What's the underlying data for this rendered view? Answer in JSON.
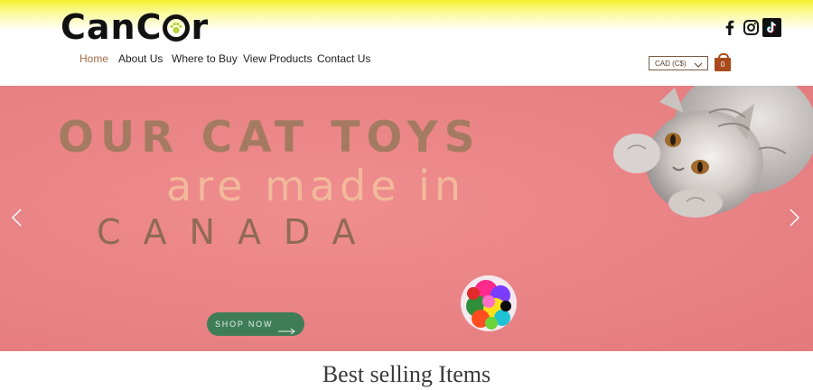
{
  "header": {
    "logo": {
      "prefix": "CanC",
      "suffix": "r"
    },
    "nav": [
      {
        "label": "Home",
        "active": true
      },
      {
        "label": "About Us",
        "active": false
      },
      {
        "label": "Where to Buy",
        "active": false
      },
      {
        "label": "View Products",
        "active": false
      },
      {
        "label": "Contact Us",
        "active": false
      }
    ],
    "social": [
      "facebook-icon",
      "instagram-icon",
      "tiktok-icon"
    ],
    "currency": "CAD (C$)",
    "cart_count": "0"
  },
  "hero": {
    "line1": "OUR CAT TOYS",
    "line2": "are made in",
    "line3": "CANADA",
    "cta": "SHOP NOW",
    "colors": {
      "background": "#e9888a",
      "button": "#3e7d55"
    }
  },
  "section": {
    "title": "Best selling Items"
  },
  "colors": {
    "accent": "#a56a45",
    "header_yellow": "#f2f02a"
  }
}
